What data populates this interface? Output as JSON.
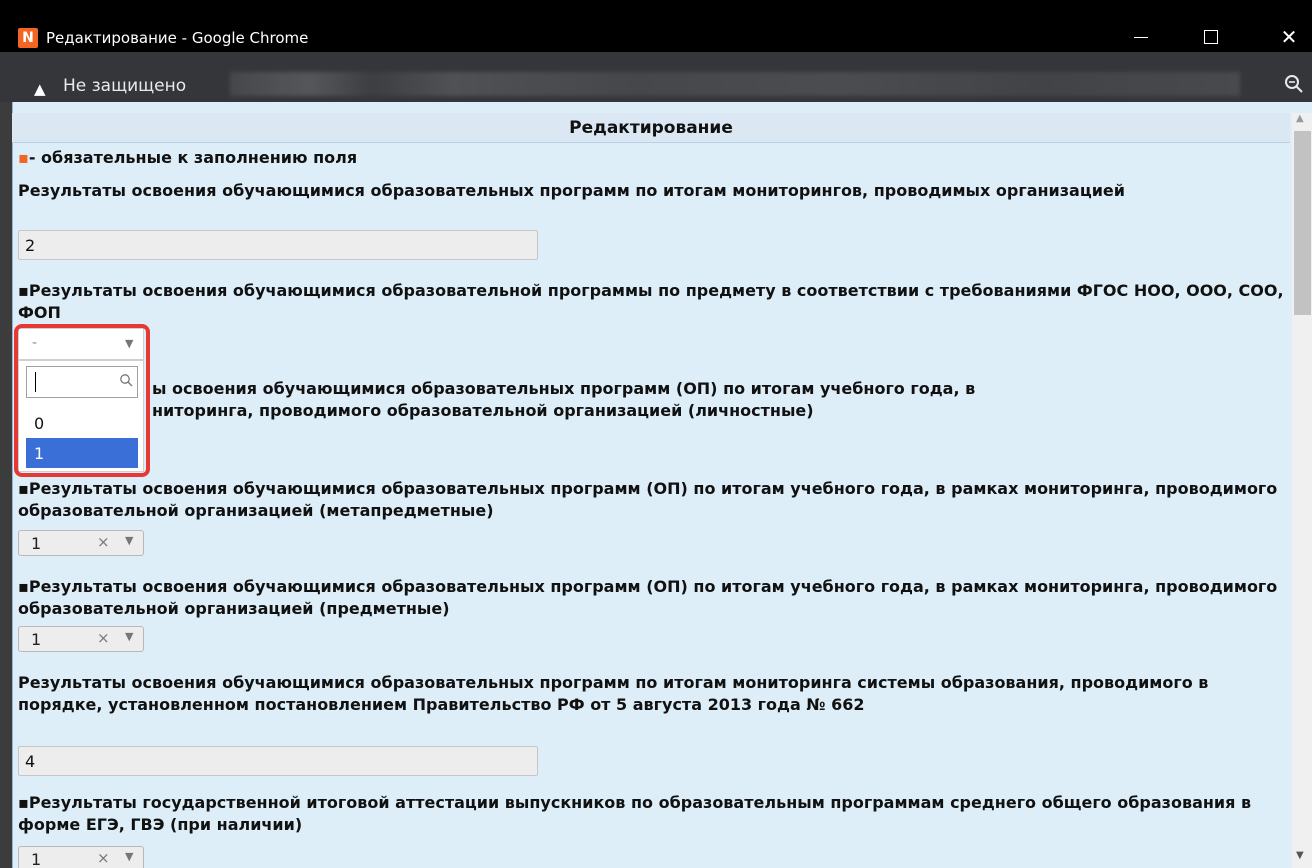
{
  "window": {
    "app_icon_letter": "N",
    "title": "Редактирование - Google Chrome",
    "minimize_icon": "minimize-icon",
    "maximize_icon": "maximize-icon",
    "close_icon": "close-icon",
    "close_glyph": "✕"
  },
  "address_bar": {
    "warning_glyph": "▲",
    "security_label": "Не защищено",
    "zoom_icon": "zoom-icon"
  },
  "dialog": {
    "title": "Редактирование",
    "required_mark": "▪",
    "required_note": "- обязательные к заполнению поля"
  },
  "fields": [
    {
      "label": "Результаты освоения обучающимися образовательных программ по итогам мониторингов, проводимых организацией",
      "value": "2"
    },
    {
      "label": "▪Результаты освоения обучающимися образовательной программы по предмету в соответствии с требованиями ФГОС НОО, ООО, СОО, ФОП",
      "value": "-"
    },
    {
      "label": "ы освоения обучающимися образовательных программ (ОП) по итогам учебного года, в",
      "label_line2": "ниторинга, проводимого образовательной организацией (личностные)"
    },
    {
      "label": "▪Результаты освоения обучающимися образовательных программ (ОП) по итогам учебного года, в рамках мониторинга, проводимого образовательной организацией (метапредметные)",
      "value": "1"
    },
    {
      "label": "▪Результаты освоения обучающимися образовательных программ (ОП) по итогам учебного года, в рамках мониторинга, проводимого образовательной организацией (предметные)",
      "value": "1"
    },
    {
      "label": "Результаты освоения обучающимися образовательных программ по итогам мониторинга системы образования, проводимого в порядке, установленном постановлением Правительство РФ от 5 августа 2013 года № 662",
      "value": "4"
    },
    {
      "label": "▪Результаты государственной итоговой аттестации выпускников по образовательным программам среднего общего образования в форме ЕГЭ, ГВЭ (при наличии)",
      "value": "1"
    }
  ],
  "select_controls": {
    "clear_glyph": "×",
    "arrow_glyph": "▼"
  },
  "dropdown": {
    "options": [
      "0",
      "1"
    ],
    "highlighted": "1"
  },
  "scrollbar": {
    "up_glyph": "▲",
    "down_glyph": "▼"
  },
  "colors": {
    "required_accent": "#f26522",
    "dialog_bg": "#ddeef8",
    "highlight_border": "#e53935",
    "selected_option": "#3a6fd8"
  }
}
